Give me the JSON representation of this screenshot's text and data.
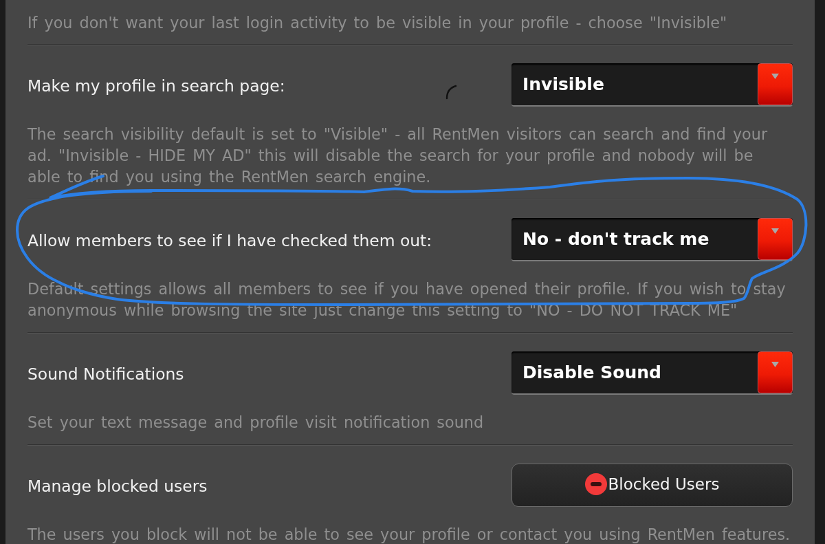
{
  "intro_note": "If you don't want your last login activity to be visible in your profile - choose \"Invisible\"",
  "settings": [
    {
      "kind": "select",
      "label": "Make my profile in search page:",
      "value": "Invisible",
      "description": "The search visibility default is set to \"Visible\" - all RentMen visitors can search and find your ad. \"Invisible - HIDE MY AD\" this will disable the search for your profile and nobody will be able to find you using the RentMen search engine.",
      "circled": false,
      "pen_mark": true
    },
    {
      "kind": "select",
      "label": "Allow members to see if I have checked them out:",
      "value": "No - don't track me",
      "description": "Default settings allows all members to see if you have opened their profile. If you wish to stay anonymous while browsing the site just change this setting to \"NO - DO NOT TRACK ME\"",
      "circled": true,
      "pen_mark": false
    },
    {
      "kind": "select",
      "label": "Sound Notifications",
      "value": "Disable Sound",
      "description": "Set your text message and profile visit notification sound",
      "circled": false,
      "pen_mark": false
    },
    {
      "kind": "button",
      "label": "Manage blocked users",
      "button_label": "Blocked Users",
      "description": "The users you block will not be able to see your profile or contact you using RentMen features.",
      "circled": false,
      "pen_mark": false
    }
  ]
}
